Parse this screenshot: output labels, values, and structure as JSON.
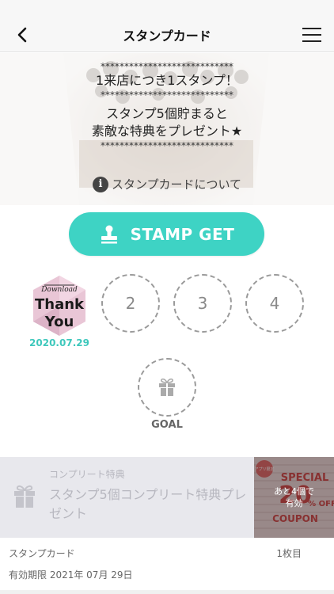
{
  "header": {
    "title": "スタンプカード"
  },
  "hero": {
    "stars": "****************************",
    "line1": "1来店につき1スタンプ！",
    "line2": "スタンプ5個貯まると",
    "line3": "素敵な特典をプレゼント★",
    "about_link": "スタンプカードについて",
    "info_icon_glyph": "i"
  },
  "stamp_button": {
    "label": "STAMP GET",
    "color": "#3ed3c4"
  },
  "stamps": {
    "stamped_logo_top": "Download",
    "stamped_logo_line1": "Thank",
    "stamped_logo_line2": "You",
    "stamped_date": "2020.07.29",
    "slot2": "2",
    "slot3": "3",
    "slot4": "4",
    "goal_label": "GOAL"
  },
  "coupon": {
    "category": "コンプリート特典",
    "title": "スタンプ5個コンプリート特典プレゼント",
    "overlay_line1": "あと4個で",
    "overlay_line2": "有効",
    "image_badge": "アプリ限定",
    "image_line1": "SPECIAL",
    "image_line2": "20",
    "image_line3": "% OFF",
    "image_line4": "COUPON"
  },
  "footer": {
    "card_label": "スタンプカード",
    "card_count": "1枚目",
    "expiry": "有効期限 2021年 07月 29日"
  }
}
